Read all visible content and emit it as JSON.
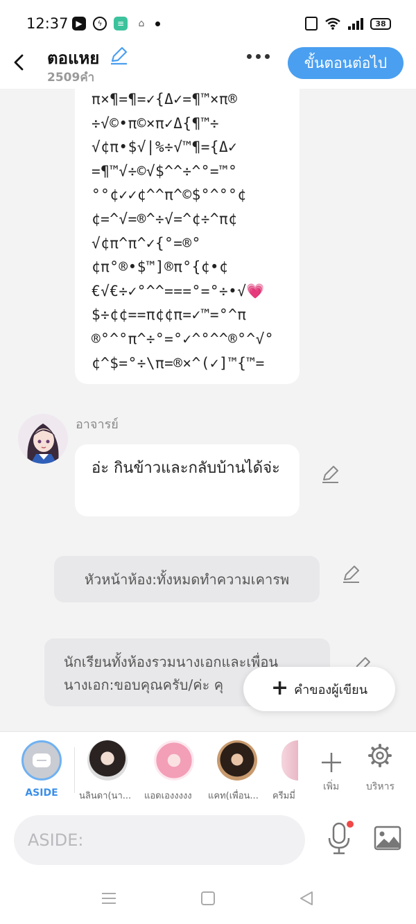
{
  "status_bar": {
    "time": "12:37",
    "battery": "38",
    "icons": [
      "youtube-icon",
      "messenger-icon",
      "line-icon",
      "game-icon",
      "vibrate-icon",
      "wifi-icon",
      "signal-icon",
      "battery-icon"
    ]
  },
  "header": {
    "title": "ตอแหย",
    "char_count": "2509คำ",
    "next_label": "ขั้นตอนต่อไป",
    "accent_color": "#4a9ff0"
  },
  "messages": {
    "top_bubble_lines": [
      "π×¶=¶=✓{Δ✓=¶™×π®",
      "÷√©•π©×π✓Δ{¶™÷",
      "√¢π•$√|%÷√™¶={Δ✓",
      "=¶™√÷©√$^^÷^°=™°",
      "°°¢✓✓¢^^π^©$°^°°¢",
      "¢=^√=®^÷√=^¢÷^π¢",
      "√¢π^π^✓{°=®°",
      "¢π°®•$™]®π°{¢•¢",
      "€√€÷✓°^^===°=°÷•√💗",
      "$÷¢¢==π¢¢π=✓™=°^π",
      "®°^°π^÷°=°✓^°^^®°^√°",
      "¢^$=°÷\\π=®×^(✓]™{™="
    ],
    "teacher_name": "อาจารย์",
    "teacher_text": "อ่ะ กินข้าวและกลับบ้านได้จ่ะ",
    "head_narration": "หัวหน้าห้อง:ทั้งหมดทำความเคารพ",
    "class_narration_line1": "นักเรียนทั้งห้องรวมนางเอกและเพื่อน",
    "class_narration_line2": "นางเอก:ขอบคุณครับ/ค่ะ คุ"
  },
  "writer_button": {
    "label": "คำของผู้เขียน"
  },
  "characters": {
    "aside_label": "ASIDE",
    "items": [
      {
        "label": "นลินดา(นา..."
      },
      {
        "label": "แอดเองงงงง"
      },
      {
        "label": "แคท(เพื่อน..."
      },
      {
        "label": "ครีมมี่"
      }
    ],
    "add_label": "เพิ่ม",
    "manage_label": "บริหาร"
  },
  "input_bar": {
    "placeholder": "ASIDE:"
  }
}
